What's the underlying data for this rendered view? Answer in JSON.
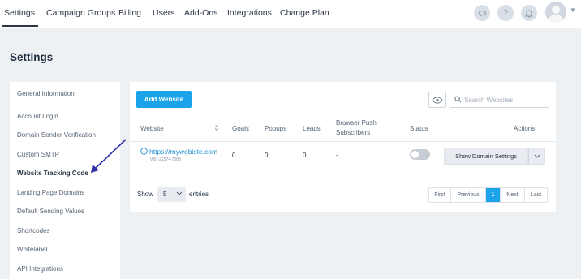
{
  "topnav": {
    "items": [
      "Settings",
      "Campaign Groups",
      "Billing",
      "Users",
      "Add-Ons",
      "Integrations",
      "Change Plan"
    ],
    "icons": [
      "chat-icon",
      "help-icon",
      "bell-icon",
      "avatar"
    ]
  },
  "page": {
    "title": "Settings"
  },
  "sidebar": {
    "items": [
      {
        "label": "General Information"
      },
      {
        "label": "Account Login"
      },
      {
        "label": "Domain Sender Verification"
      },
      {
        "label": "Custom SMTP"
      },
      {
        "label": "Website Tracking Code",
        "active": true
      },
      {
        "label": "Landing Page Domains"
      },
      {
        "label": "Default Sending Values"
      },
      {
        "label": "Shortcodes"
      },
      {
        "label": "Whitelabel"
      },
      {
        "label": "API Integrations"
      }
    ]
  },
  "main": {
    "add_button": "Add Website",
    "search_placeholder": "Search Websites",
    "columns": [
      "Website",
      "Goals",
      "Popups",
      "Leads",
      "Browser Push Subscribers",
      "Status",
      "Actions"
    ],
    "rows": [
      {
        "website": "https://mywebiste.com",
        "site_id": "VB1-21574-7088",
        "goals": "0",
        "popups": "0",
        "leads": "0",
        "push_subscribers": "-",
        "status_on": false,
        "action": "Show Domain Settings"
      }
    ],
    "footer": {
      "show_label": "Show",
      "page_length": "5",
      "entries_label": "entries",
      "pagination": [
        "First",
        "Previous",
        "1",
        "Next",
        "Last"
      ],
      "current_page": "1"
    }
  },
  "colors": {
    "accent": "#1aa3e8",
    "link": "#1a8fd6",
    "annotation_arrow": "#2e2fa8"
  }
}
